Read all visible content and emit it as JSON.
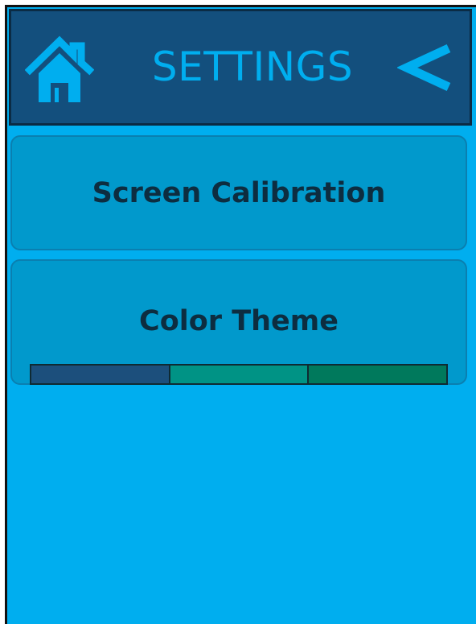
{
  "header": {
    "title": "SETTINGS",
    "home_icon": "home-icon",
    "back_icon": "back-chevron-icon"
  },
  "menu": {
    "screen_calibration_label": "Screen Calibration",
    "color_theme_label": "Color Theme"
  },
  "theme_swatches": [
    {
      "name": "blue",
      "color": "#1c4f7c"
    },
    {
      "name": "teal",
      "color": "#009385"
    },
    {
      "name": "green",
      "color": "#00795c"
    }
  ],
  "colors": {
    "background": "#00aeef",
    "header_bg": "#134f7d",
    "card_bg": "#0199cc",
    "accent": "#00aeef",
    "label_text": "#0d2d40"
  }
}
